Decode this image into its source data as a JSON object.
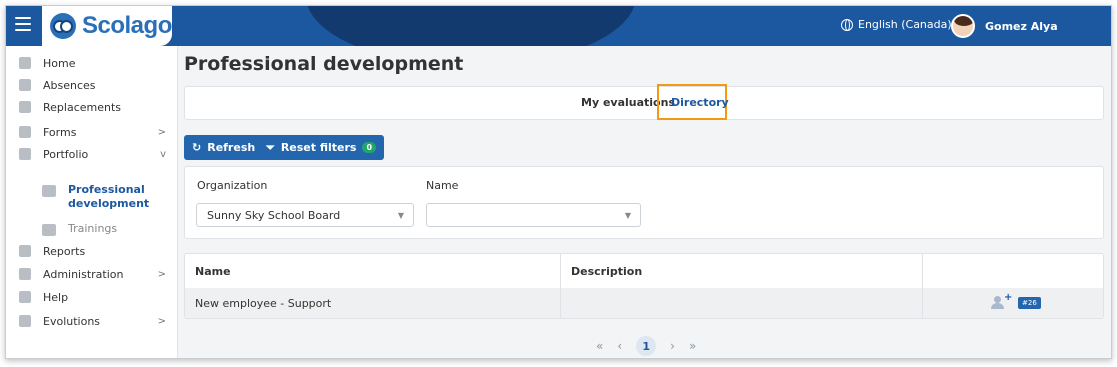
{
  "header": {
    "app_name": "Scolago",
    "language": "English (Canada)",
    "user_name": "Gomez Alya"
  },
  "sidebar": {
    "items": [
      {
        "label": "Home",
        "icon": "home-icon"
      },
      {
        "label": "Absences",
        "icon": "absences-icon"
      },
      {
        "label": "Replacements",
        "icon": "replacements-icon"
      },
      {
        "label": "Forms",
        "icon": "forms-icon",
        "chevron": ">"
      },
      {
        "label": "Portfolio",
        "icon": "trophy-icon",
        "chevron": "v"
      },
      {
        "label": "Reports",
        "icon": "reports-icon"
      },
      {
        "label": "Administration",
        "icon": "gear-icon",
        "chevron": ">"
      },
      {
        "label": "Help",
        "icon": "help-icon"
      },
      {
        "label": "Evolutions",
        "icon": "sprout-icon",
        "chevron": ">"
      }
    ],
    "portfolio_subitems": [
      {
        "label": "Professional development",
        "active": true
      },
      {
        "label": "Trainings",
        "active": false
      }
    ]
  },
  "main": {
    "title": "Professional development",
    "tabs": [
      {
        "label": "My evaluations"
      },
      {
        "label": "Directory"
      }
    ],
    "buttons": {
      "refresh": "Refresh",
      "reset_filters": "Reset filters",
      "reset_filters_count": "0"
    },
    "filters": {
      "organization_label": "Organization",
      "organization_value": "Sunny Sky School Board",
      "name_label": "Name",
      "name_value": ""
    },
    "table": {
      "columns": [
        "Name",
        "Description",
        ""
      ],
      "rows": [
        {
          "name": "New employee - Support",
          "description": "",
          "id_badge": "#26"
        }
      ]
    },
    "pagination": {
      "first": "«",
      "prev": "‹",
      "current": "1",
      "next": "›",
      "last": "»"
    }
  },
  "colors": {
    "primary": "#1c58a0",
    "button": "#2466ae",
    "highlight": "#f29a12",
    "success": "#20a66a"
  }
}
